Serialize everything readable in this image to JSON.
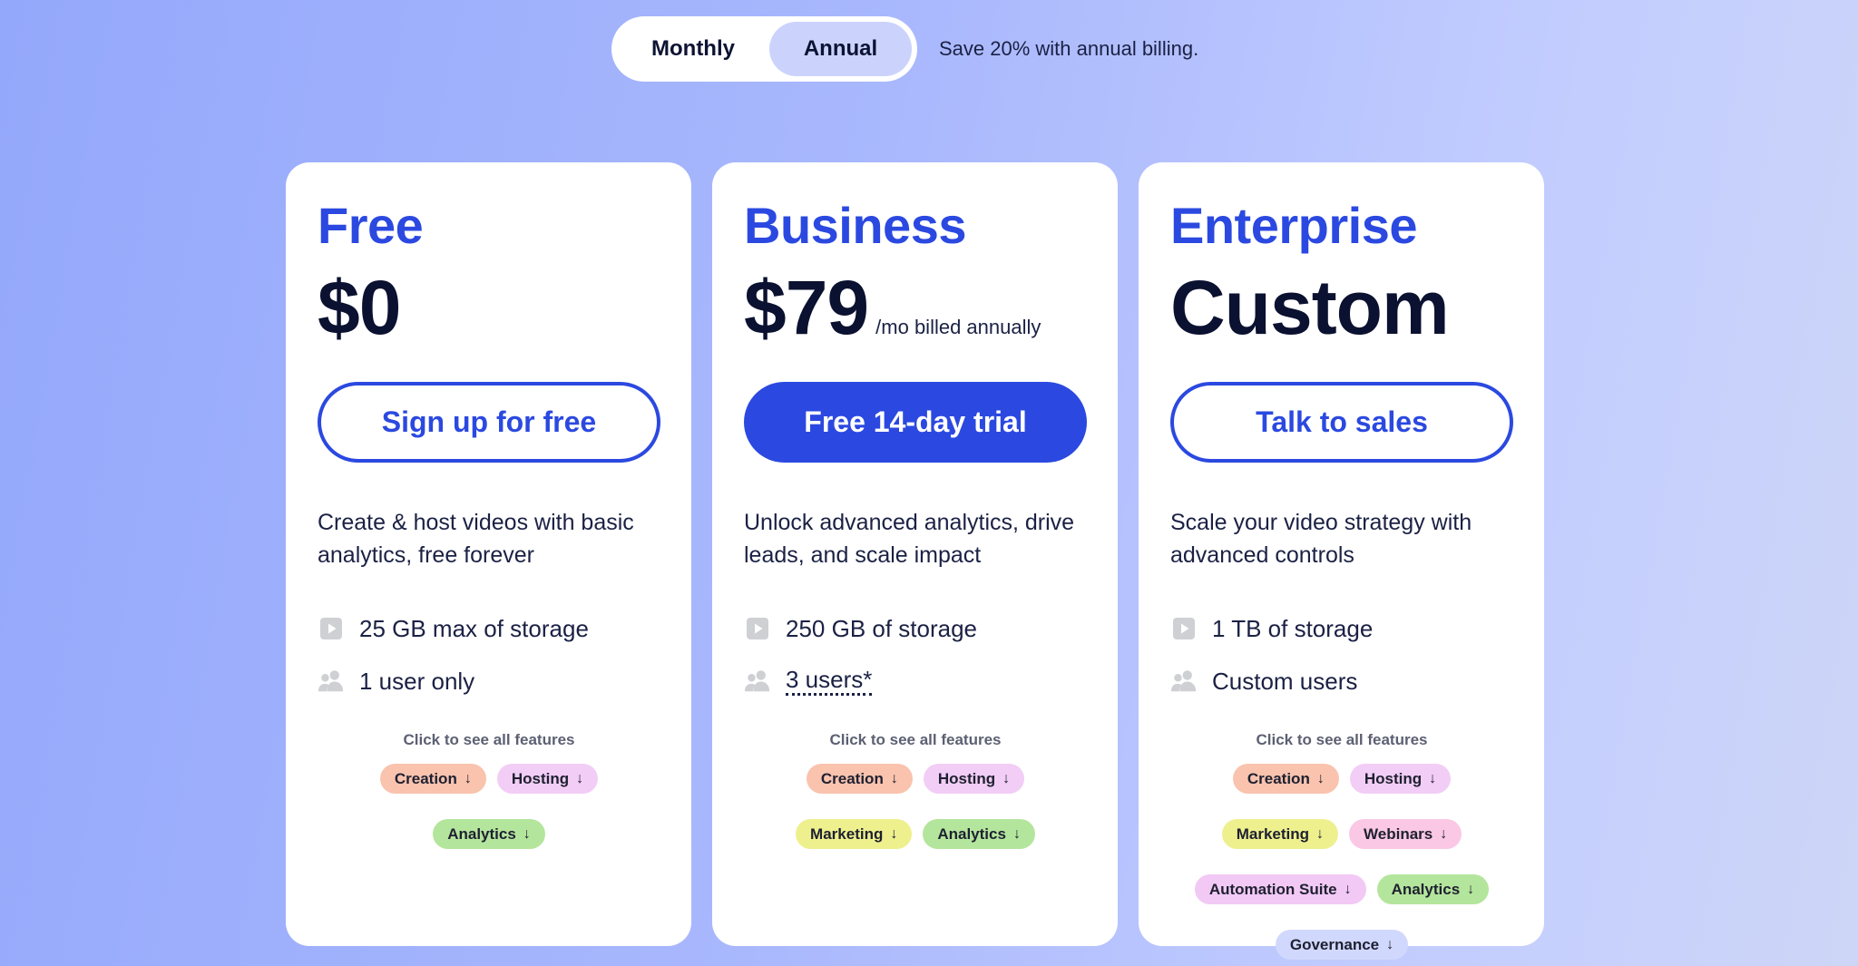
{
  "billing_toggle": {
    "monthly_label": "Monthly",
    "annual_label": "Annual",
    "selected": "Annual",
    "save_note": "Save 20% with annual billing."
  },
  "colors": {
    "brand_blue": "#2b49e0",
    "dark_text": "#0b1130",
    "selected_toggle": "#cbd3fd"
  },
  "plans": [
    {
      "name": "Free",
      "price": "$0",
      "price_suffix": "",
      "cta": "Sign up for free",
      "cta_style": "outline",
      "description": "Create & host videos with basic analytics, free forever",
      "storage": "25 GB max of storage",
      "users": "1 user only",
      "see_all": "Click to see all features",
      "tags": [
        "Creation",
        "Hosting",
        "Analytics"
      ]
    },
    {
      "name": "Business",
      "price": "$79",
      "price_suffix": "/mo billed annually",
      "cta": "Free 14-day trial",
      "cta_style": "solid",
      "description": "Unlock advanced analytics, drive leads, and scale impact",
      "storage": "250 GB of storage",
      "users": "3 users*",
      "see_all": "Click to see all features",
      "tags": [
        "Creation",
        "Hosting",
        "Marketing",
        "Analytics"
      ]
    },
    {
      "name": "Enterprise",
      "price": "Custom",
      "price_suffix": "",
      "cta": "Talk to sales",
      "cta_style": "outline",
      "description": "Scale your video strategy with advanced controls",
      "storage": "1 TB of storage",
      "users": "Custom users",
      "see_all": "Click to see all features",
      "tags": [
        "Creation",
        "Hosting",
        "Marketing",
        "Webinars",
        "Automation Suite",
        "Analytics",
        "Governance"
      ]
    }
  ],
  "icons": {
    "storage": "video-play-icon",
    "users": "users-icon",
    "tag_arrow": "arrow-down-icon"
  }
}
